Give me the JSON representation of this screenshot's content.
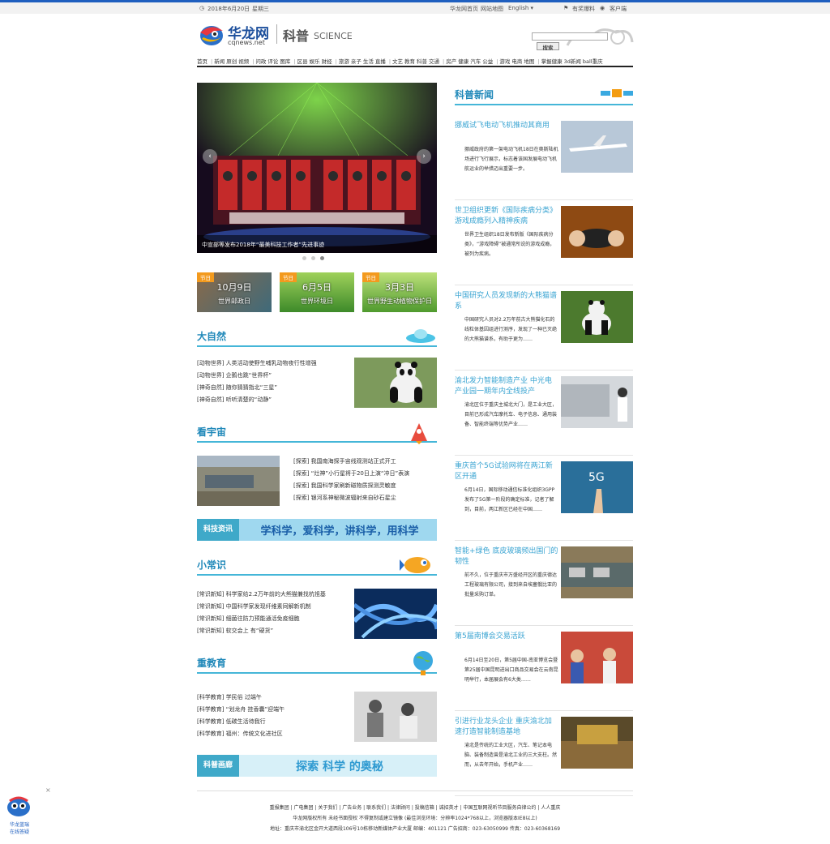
{
  "topbar": {
    "date": "2018年6月20日",
    "weekday": "星期三",
    "links": [
      "华龙网首页",
      "网站地图",
      "English ▾"
    ],
    "report": "有奖爆料",
    "client": "客户端"
  },
  "header": {
    "logo_cn": "华龙网",
    "logo_domain": "cqnews.net",
    "channel_cn": "科普",
    "channel_en": "SCIENCE",
    "search_button": "搜索"
  },
  "nav": [
    [
      "首页"
    ],
    [
      "新闻",
      "原创",
      "视频"
    ],
    [
      "问政",
      "评论",
      "图库"
    ],
    [
      "区县",
      "娱乐",
      "财经"
    ],
    [
      "旅游",
      "亲子",
      "生活",
      "直播"
    ],
    [
      "文艺",
      "教育",
      "科普",
      "交通"
    ],
    [
      "房产",
      "健康",
      "汽车",
      "公益"
    ],
    [
      "游戏",
      "电商",
      "地图"
    ],
    [
      "掌握健康",
      "3d新闻",
      "ball重庆"
    ]
  ],
  "hero": {
    "caption": "中宣部等发布2018年“最美科技工作者”先进事迹",
    "prev": "‹",
    "next": "›"
  },
  "festivals": [
    {
      "tag": "节日",
      "date": "10月9日",
      "name": "世界邮政日"
    },
    {
      "tag": "节日",
      "date": "6月5日",
      "name": "世界环境日"
    },
    {
      "tag": "节日",
      "date": "3月3日",
      "name": "世界野生动植物保护日"
    }
  ],
  "nature": {
    "title": "大自然",
    "items": [
      "[动物世界]  人类活动使野生哺乳动物夜行性增强",
      "[动物世界]  企鹅也跳“世界杯”",
      "[神奇自然]  随你猜猜指北“三星”",
      "[神奇自然]  听听清楚的“动静”"
    ]
  },
  "universe": {
    "title": "看宇宙",
    "items": [
      "[探索]  我国南海探手宙线观测站正式开工",
      "[探索]  “灶神”小行星将于20日上演“冲日”表演",
      "[探索]  我国科学家刷新磁物质探测灵敏度",
      "[探索]  银河系神秘微波辐射来自砂石星尘"
    ]
  },
  "banner1": {
    "label": "科技资讯",
    "text": "学科学，爱科学，讲科学，用科学"
  },
  "knowledge": {
    "title": "小常识",
    "items": [
      "[常识新知]  科学家给2.2万年前的大熊猫兼找杭祖基",
      "[常识新知]  中国科学家发现纤维素同解新机制",
      "[常识新知]  细菌往防力预能通活免疫细胞",
      "[常识新知]  软交会上 有“硬货”"
    ]
  },
  "education": {
    "title": "重教育",
    "items": [
      "[科学教育]  学民俗 过端午",
      "[科学教育]  “划龙舟 挂香囊”迎端午",
      "[科学教育]  低碳生活待我行",
      "[科学教育]  福州：传统文化进社区"
    ]
  },
  "banner2": {
    "label": "科普画廊",
    "text": "探索 科学 的奥秘"
  },
  "sci_news": {
    "title": "科普新闻",
    "items": [
      {
        "title": "挪威试飞电动飞机推动其商用",
        "summary": "挪威政府的第一架电动飞机18日在奥斯陆机场进行飞行展示，标志着该国发展电动飞机航运业的举措迈出重要一步。"
      },
      {
        "title": "世卫组织更新《国际疾病分类》 游戏成瘾列入精神疾病",
        "summary": "世界卫生组织18日发布新版《国际疾病分类》，“游戏障碍”被通常所说的游戏成瘾，被列为疾病。"
      },
      {
        "title": "中国研究人员发现新的大熊猫谱系",
        "summary": "中国研究人员对2.2万年前古大熊猫化石的线粒体基因组进行测序，发现了一种已灭绝的大熊猫谱系，有助于更为……"
      },
      {
        "title": "渝北发力智能制造产业 中光电产业园一期年内全线投产",
        "summary": "渝北区位于重庆主城北大门，是工业大区，目前已形成汽车摩托车、电子信息、通用装备、智能终端等优势产业……"
      },
      {
        "title": "重庆首个5G试验网将在两江新区开通",
        "summary": "6月14日，国际移动通信标准化组织3GPP发布了5G第一阶段的确定标准，记者了解到，目前，两江新区已经在中国……"
      },
      {
        "title": "智能+绿色 底皮玻璃频出国门的韧性",
        "summary": "前不久，位于重庆市万盛经开区的重庆德达工程玻璃有限公司，接到来自埃塞俄比亚的批量采购订单。"
      },
      {
        "title": "第5届南博会交易活跃",
        "summary": "6月14日至20日，第5届中国-南亚博览会暨第25届中国昆明进出口商品交易会在云南昆明举行，本届展会有6大类……"
      },
      {
        "title": "引进行业龙头企业 重庆渝北加速打造智能制造基地",
        "summary": "渝北是传统的工业大区，汽车、笔记本电脑、装备制造曾是渝北工业的三大支柱。然而，从去年开始，手机产业……"
      }
    ]
  },
  "footer": {
    "links": [
      "重报集团",
      "广电集团",
      "关于我们",
      "广告业务",
      "联系我们",
      "法律顾问",
      "投稿信箱",
      "诚招英才",
      "中国互联网视听节目服务自律公约",
      "人人重庆"
    ],
    "line2": "华龙网版权所有 未经书面授权 不得复制或建立镜像   (最佳浏览环境：分辨率1024*768以上，浏览器版本IE8以上)",
    "line3": "地址：重庆市渝北区金开大道西段106号10栋移动新媒体产业大厦  邮编：401121  广告招商：023-63050999  传真：023-60368169"
  },
  "float_ad": {
    "line1": "华龙蓝瑞",
    "line2": "在线答疑",
    "close": "×"
  }
}
